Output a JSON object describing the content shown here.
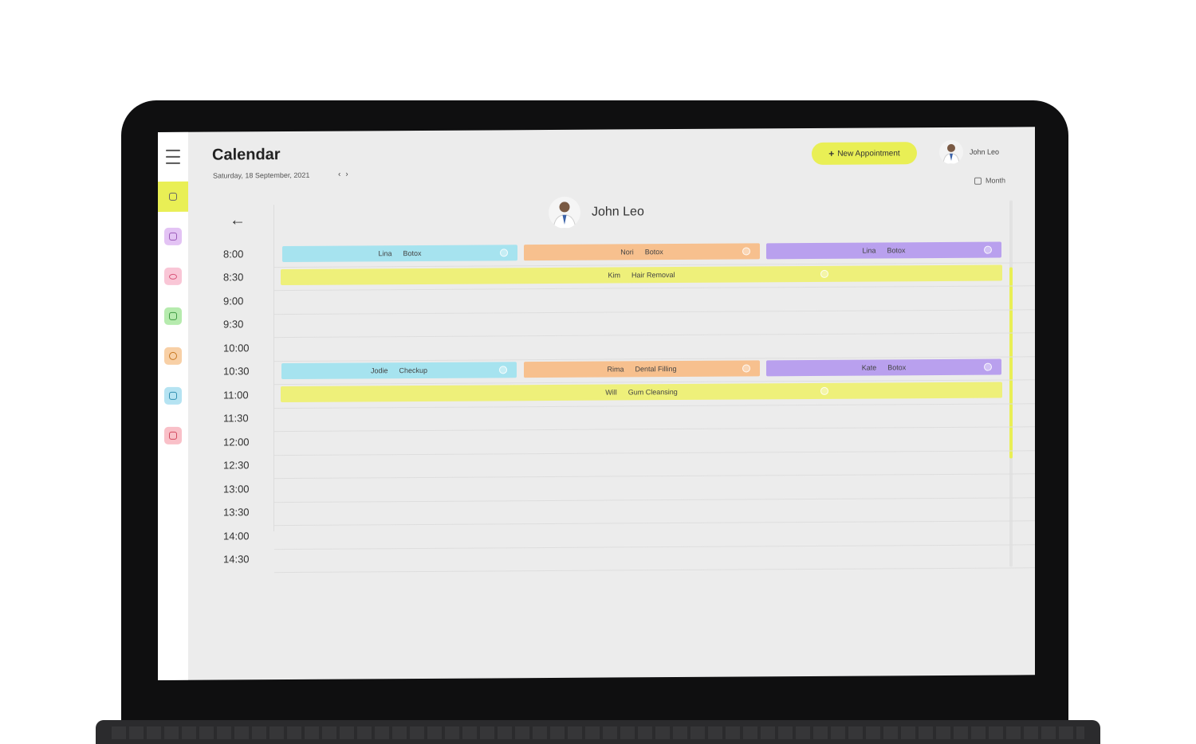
{
  "calendar": {
    "title": "Calendar",
    "date": "Saturday, 18 September, 2021",
    "prev": "‹",
    "next": "›",
    "new_appointment": "New Appointment",
    "user_name": "John Leo",
    "month_label": "Month",
    "doctor_name": "John Leo"
  },
  "sidebar": {
    "items": [
      {
        "icon": "calendar-icon",
        "color": "#e9ef55"
      },
      {
        "icon": "document-icon",
        "color": "#d9a5f0"
      },
      {
        "icon": "lips-icon",
        "color": "#f6b0c8"
      },
      {
        "icon": "list-icon",
        "color": "#a8e6a0"
      },
      {
        "icon": "hexagon-icon",
        "color": "#f6c08a"
      },
      {
        "icon": "briefcase-icon",
        "color": "#9ed9ec"
      },
      {
        "icon": "logout-icon",
        "color": "#f6a6b2"
      }
    ]
  },
  "times": [
    "8:00",
    "8:30",
    "9:00",
    "9:30",
    "10:00",
    "10:30",
    "11:00",
    "11:30",
    "12:00",
    "12:30",
    "13:00",
    "13:30",
    "14:00",
    "14:30"
  ],
  "events": [
    {
      "name": "Lina",
      "service": "Botox"
    },
    {
      "name": "Nori",
      "service": "Botox"
    },
    {
      "name": "Lina",
      "service": "Botox"
    },
    {
      "name": "Kim",
      "service": "Hair Removal"
    },
    {
      "name": "Jodie",
      "service": "Checkup"
    },
    {
      "name": "Rima",
      "service": "Dental Filling"
    },
    {
      "name": "Kate",
      "service": "Botox"
    },
    {
      "name": "Will",
      "service": "Gum Cleansing"
    }
  ],
  "colors": {
    "accent": "#e9ef55",
    "blue": "#a6e3ef",
    "orange": "#f7c08e",
    "purple": "#b9a0ee",
    "yellow": "#eef07a"
  }
}
